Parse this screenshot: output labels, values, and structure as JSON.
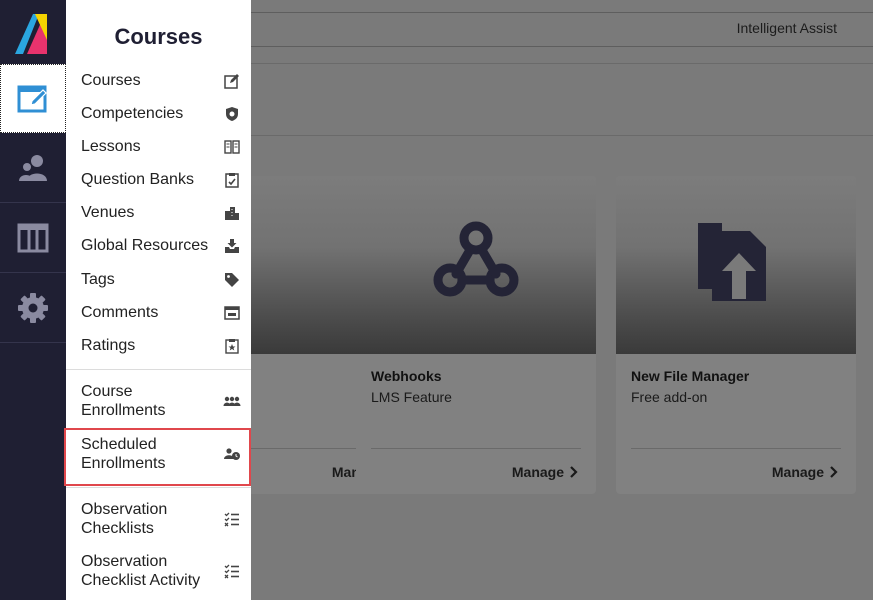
{
  "header": {
    "assist_label": "Intelligent Assist"
  },
  "menu": {
    "title": "Courses",
    "items": [
      {
        "label": "Courses",
        "icon": "edit-square-icon"
      },
      {
        "label": "Competencies",
        "icon": "badge-shield-icon"
      },
      {
        "label": "Lessons",
        "icon": "book-icon"
      },
      {
        "label": "Question Banks",
        "icon": "checklist-box-icon"
      },
      {
        "label": "Venues",
        "icon": "buildings-icon"
      },
      {
        "label": "Global Resources",
        "icon": "download-tray-icon"
      },
      {
        "label": "Tags",
        "icon": "tags-icon"
      },
      {
        "label": "Comments",
        "icon": "comment-box-icon"
      },
      {
        "label": "Ratings",
        "icon": "rating-clipboard-icon"
      },
      {
        "label": "Course Enrollments",
        "icon": "group-users-icon"
      },
      {
        "label": "Scheduled Enrollments",
        "icon": "scheduled-users-icon"
      },
      {
        "label": "Observation Checklists",
        "icon": "checklist-icon"
      },
      {
        "label": "Observation Checklist Activity",
        "icon": "checklist-activity-icon"
      }
    ],
    "highlighted_item": "Scheduled Enrollments"
  },
  "rail": {
    "items": [
      "courses-icon",
      "users-icon",
      "columns-icon",
      "settings-gear-icon"
    ],
    "active": "courses-icon"
  },
  "cards": [
    {
      "title": "",
      "subtitle": "",
      "manage": "Manage",
      "icon": ""
    },
    {
      "title": "Webhooks",
      "subtitle": "LMS Feature",
      "manage": "Manage",
      "icon": "webhook-icon"
    },
    {
      "title": "New File Manager",
      "subtitle": "Free add-on",
      "manage": "Manage",
      "icon": "file-upload-icon"
    }
  ],
  "colors": {
    "rail_bg": "#1f1f33",
    "highlight_border": "#e0474c",
    "overlay": "#7a7a7a"
  }
}
